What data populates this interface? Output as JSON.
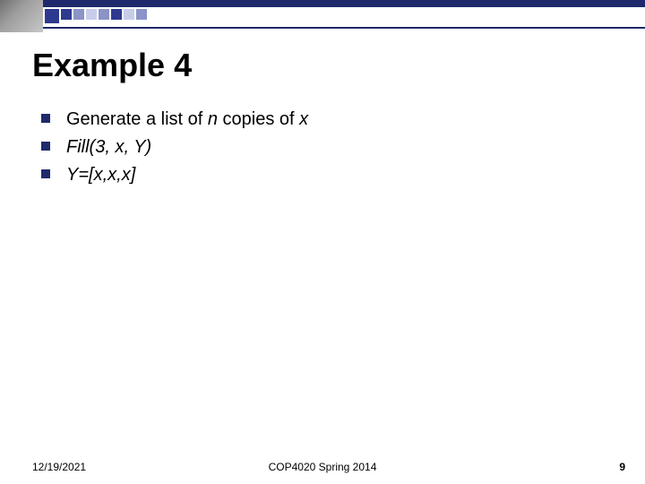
{
  "slide": {
    "title": "Example 4",
    "bullets": [
      {
        "plain": "Generate a list of ",
        "em1": "n",
        "mid": " copies of ",
        "em2": "x"
      },
      {
        "full_italic": "Fill(3, x, Y)"
      },
      {
        "full_italic": "Y=[x,x,x]"
      }
    ]
  },
  "footer": {
    "date": "12/19/2021",
    "course": "COP4020 Spring 2014",
    "page": "9"
  }
}
